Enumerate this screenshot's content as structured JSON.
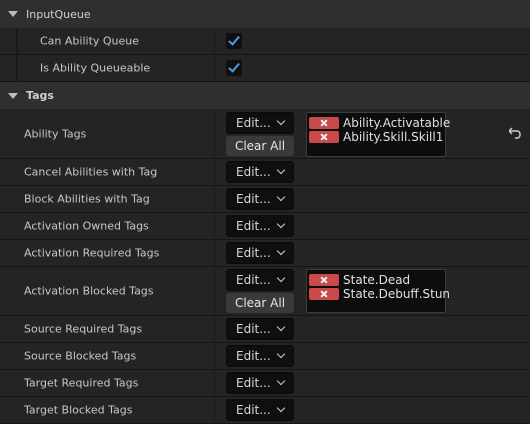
{
  "categories": {
    "input_queue": "InputQueue",
    "tags": "Tags"
  },
  "input_queue_rows": [
    {
      "label": "Can Ability Queue",
      "checked": true
    },
    {
      "label": "Is Ability Queueable",
      "checked": true
    }
  ],
  "tag_rows": [
    {
      "label": "Ability Tags",
      "combo": "Edit...",
      "clear": "Clear All",
      "tags": [
        "Ability.Activatable",
        "Ability.Skill.Skill1"
      ]
    },
    {
      "label": "Cancel Abilities with Tag",
      "combo": "Edit..."
    },
    {
      "label": "Block Abilities with Tag",
      "combo": "Edit..."
    },
    {
      "label": "Activation Owned Tags",
      "combo": "Edit..."
    },
    {
      "label": "Activation Required Tags",
      "combo": "Edit..."
    },
    {
      "label": "Activation Blocked Tags",
      "combo": "Edit...",
      "clear": "Clear All",
      "tags": [
        "State.Dead",
        "State.Debuff.Stun"
      ]
    },
    {
      "label": "Source Required Tags",
      "combo": "Edit..."
    },
    {
      "label": "Source Blocked Tags",
      "combo": "Edit..."
    },
    {
      "label": "Target Required Tags",
      "combo": "Edit..."
    },
    {
      "label": "Target Blocked Tags",
      "combo": "Edit..."
    }
  ],
  "icons": {
    "category_toggle": "triangle-down-icon",
    "checkbox": "checkmark-icon",
    "tag_remove": "x-icon",
    "reset": "reset-arrow-icon"
  },
  "colors": {
    "check_accent": "#4d9ae8",
    "remove_button": "#c94a4a"
  }
}
